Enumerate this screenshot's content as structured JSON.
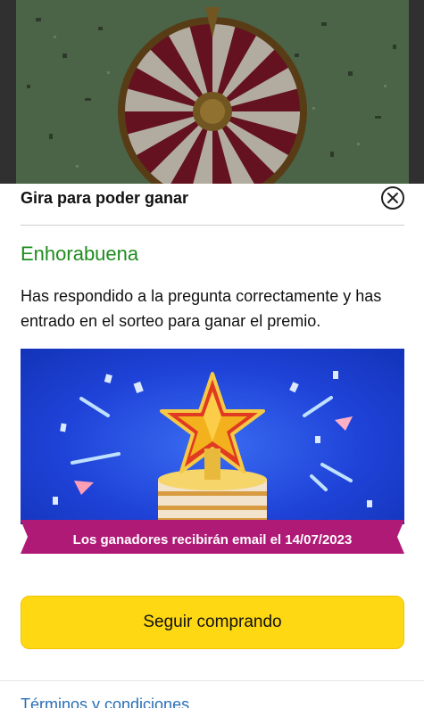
{
  "modal": {
    "title": "Gira para poder ganar",
    "success_heading": "Enhorabuena",
    "message": "Has respondido a la pregunta correctamente y has entrado en el sorteo para ganar el premio.",
    "banner_ribbon": "Los ganadores recibirán email el 14/07/2023",
    "primary_button": "Seguir comprando",
    "terms_link": "Términos y condiciones"
  },
  "colors": {
    "success": "#1e8c1e",
    "cta_background": "#ffd814",
    "ribbon": "#b01a77",
    "banner_blue": "#1f43d8",
    "link": "#2a6fb5"
  },
  "icons": {
    "close": "close-circle-icon",
    "wheel": "prize-wheel",
    "trophy": "star-trophy"
  }
}
